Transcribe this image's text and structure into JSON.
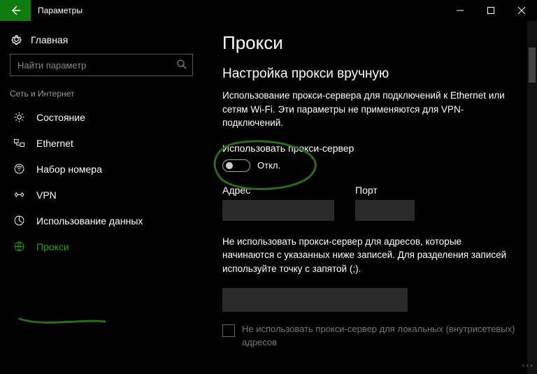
{
  "titlebar": {
    "title": "Параметры"
  },
  "home": {
    "label": "Главная"
  },
  "search": {
    "placeholder": "Найти параметр"
  },
  "section": {
    "header": "Сеть и Интернет"
  },
  "nav": {
    "items": [
      {
        "label": "Состояние"
      },
      {
        "label": "Ethernet"
      },
      {
        "label": "Набор номера"
      },
      {
        "label": "VPN"
      },
      {
        "label": "Использование данных"
      },
      {
        "label": "Прокси"
      }
    ]
  },
  "main": {
    "heading": "Прокси",
    "subheading": "Настройка прокси вручную",
    "description": "Использование прокси-сервера для подключений к Ethernet или сетям Wi-Fi. Эти параметры не применяются для VPN-подключений.",
    "toggle_label": "Использовать прокси-сервер",
    "toggle_state": "Откл.",
    "addr_label": "Адрес",
    "port_label": "Порт",
    "exceptions_desc": "Не использовать прокси-сервер для адресов, которые начинаются с указанных ниже записей. Для разделения записей используйте точку с запятой (;).",
    "checkbox_label": "Не использовать прокси-сервер для локальных (внутрисетевых) адресов"
  }
}
